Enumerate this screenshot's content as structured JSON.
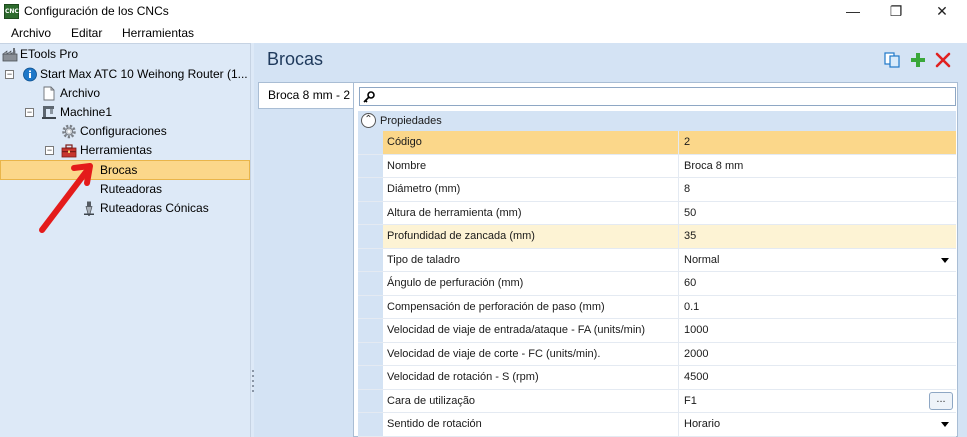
{
  "window": {
    "title": "Configuración de los CNCs",
    "app_icon_text": "CNC",
    "minimize": "—",
    "maximize": "❐",
    "close": "✕"
  },
  "menu": [
    "Archivo",
    "Editar",
    "Herramientas"
  ],
  "tree": {
    "root": "ETools Pro",
    "machine_group": "Start Max ATC 10 Weihong Router (1...",
    "archivo": "Archivo",
    "machine": "Machine1",
    "configuraciones": "Configuraciones",
    "herramientas": "Herramientas",
    "brocas": "Brocas",
    "ruteadoras": "Ruteadoras",
    "ruteadoras_conicas": "Ruteadoras Cónicas",
    "expanded_symbol": "−"
  },
  "right_panel": {
    "title": "Brocas",
    "tab_label": "Broca 8 mm - 2",
    "group_label": "Propiedades",
    "group_toggle": "⌃",
    "ellipsis": "..."
  },
  "properties": [
    {
      "name": "Código",
      "value": "2",
      "state": "active"
    },
    {
      "name": "Nombre",
      "value": "Broca 8 mm",
      "state": "normal"
    },
    {
      "name": "Diámetro (mm)",
      "value": "8",
      "state": "normal"
    },
    {
      "name": "Altura de herramienta (mm)",
      "value": "50",
      "state": "normal"
    },
    {
      "name": "Profundidad de zancada (mm)",
      "value": "35",
      "state": "modified"
    },
    {
      "name": "Tipo de taladro",
      "value": "Normal",
      "state": "dropdown"
    },
    {
      "name": "Ángulo de perfuración (mm)",
      "value": "60",
      "state": "normal"
    },
    {
      "name": "Compensación de perforación de paso (mm)",
      "value": "0.1",
      "state": "normal"
    },
    {
      "name": "Velocidad de viaje de entrada/ataque - FA (units/min)",
      "value": "1000",
      "state": "normal"
    },
    {
      "name": "Velocidad de viaje de corte - FC (units/min).",
      "value": "2000",
      "state": "normal"
    },
    {
      "name": "Velocidad de rotación - S (rpm)",
      "value": "4500",
      "state": "normal"
    },
    {
      "name": "Cara de utilização",
      "value": "F1",
      "state": "ellipsis"
    },
    {
      "name": "Sentido de rotación",
      "value": "Horario",
      "state": "dropdown"
    }
  ],
  "colors": {
    "selection": "#fbd78a",
    "modified_row": "#fdf3d4",
    "panel_bg": "#d4e3f4",
    "tree_bg": "#dde9f7",
    "annotation_arrow": "#e41b1b",
    "delete_icon": "#e02020",
    "add_icon": "#3aa83a"
  }
}
